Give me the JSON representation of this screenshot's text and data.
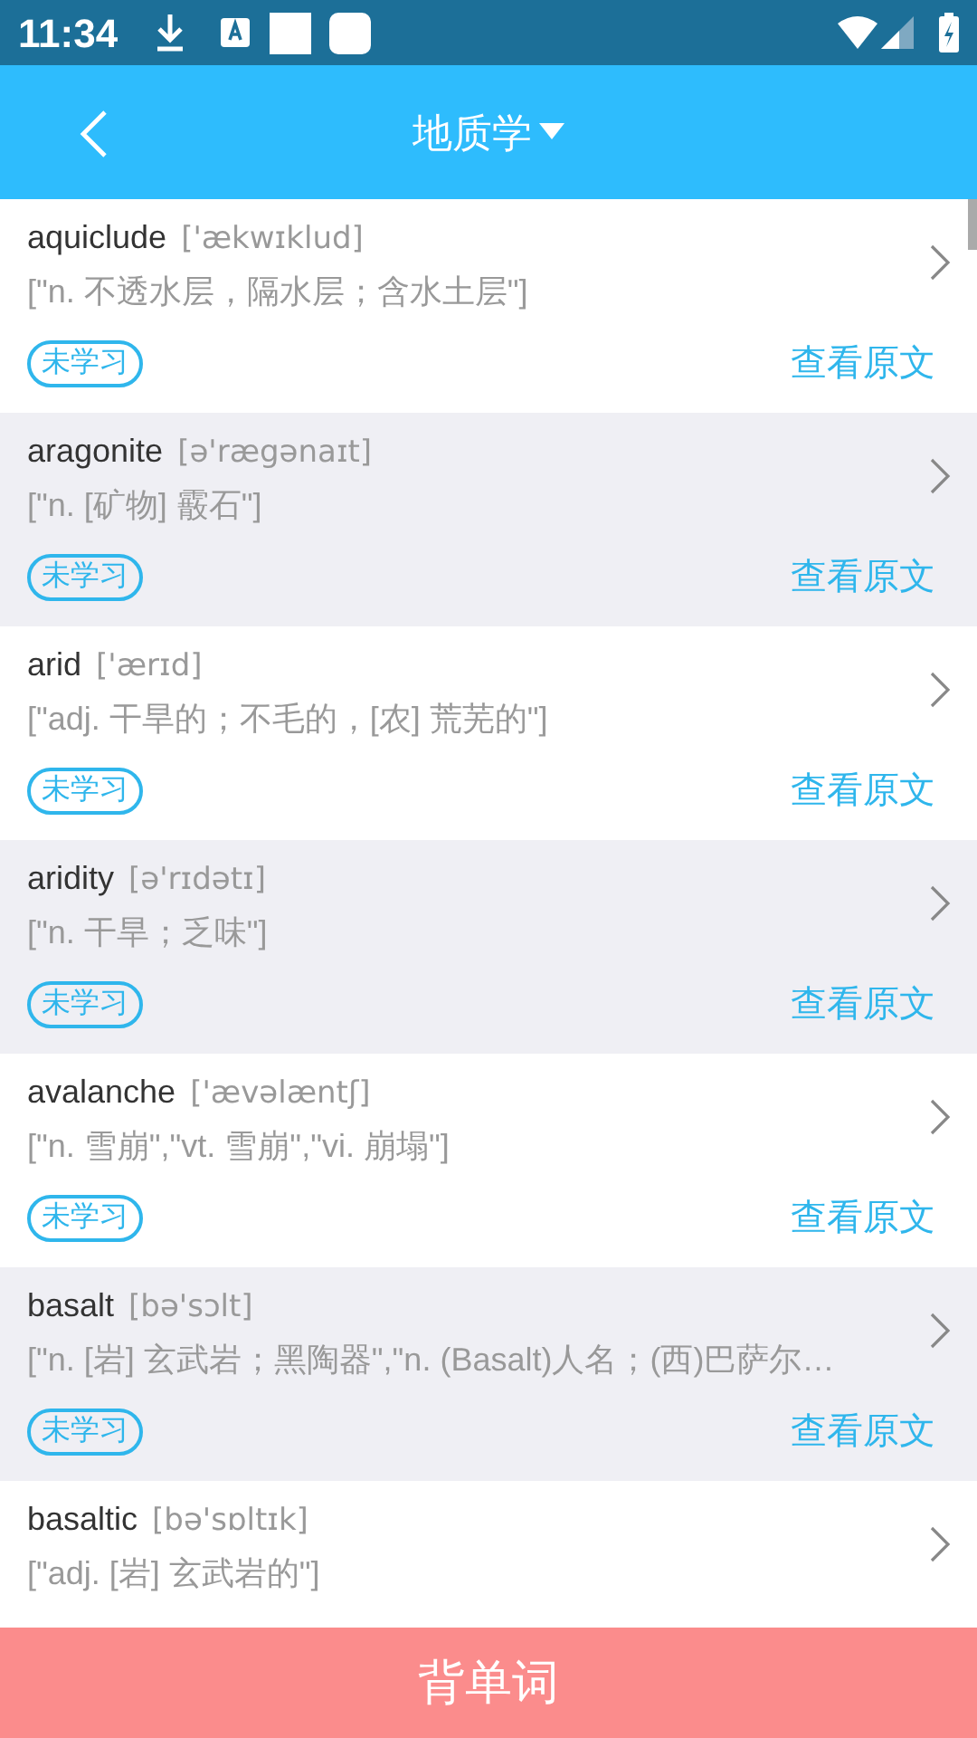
{
  "status_bar": {
    "time": "11:34"
  },
  "header": {
    "title": "地质学"
  },
  "words": [
    {
      "word": "aquiclude",
      "phonetic": "['ækwɪklud]",
      "definition": "[\"n. 不透水层，隔水层；含水土层\"]",
      "status": "未学习",
      "link": "查看原文"
    },
    {
      "word": "aragonite",
      "phonetic": "[ə'rægənaɪt]",
      "definition": "[\"n. [矿物] 霰石\"]",
      "status": "未学习",
      "link": "查看原文"
    },
    {
      "word": "arid",
      "phonetic": "['ærɪd]",
      "definition": "[\"adj. 干旱的；不毛的，[农] 荒芜的\"]",
      "status": "未学习",
      "link": "查看原文"
    },
    {
      "word": "aridity",
      "phonetic": "[ə'rɪdətɪ]",
      "definition": "[\"n. 干旱；乏味\"]",
      "status": "未学习",
      "link": "查看原文"
    },
    {
      "word": "avalanche",
      "phonetic": "['ævəlæntʃ]",
      "definition": "[\"n. 雪崩\",\"vt. 雪崩\",\"vi. 崩塌\"]",
      "status": "未学习",
      "link": "查看原文"
    },
    {
      "word": "basalt",
      "phonetic": "[bə'sɔlt]",
      "definition": "[\"n. [岩] 玄武岩；黑陶器\",\"n. (Basalt)人名；(西)巴萨尔…",
      "status": "未学习",
      "link": "查看原文"
    },
    {
      "word": "basaltic",
      "phonetic": "[bə'sɒltɪk]",
      "definition": "[\"adj. [岩] 玄武岩的\"]"
    }
  ],
  "bottom_button": {
    "label": "背单词"
  }
}
